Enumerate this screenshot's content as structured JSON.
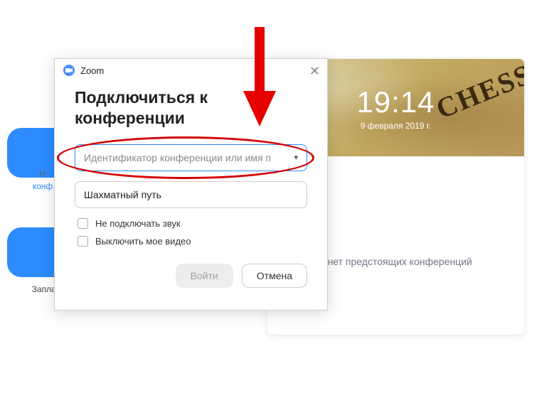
{
  "bg": {
    "tile1_label_top": "Н",
    "tile1_label_bottom": "конф",
    "tile2_label": "Заплан"
  },
  "calendar": {
    "time": "19:14",
    "date": "9 февраля 2019 г.",
    "decor_text": "CHESS",
    "body_text": "я нет предстоящих конференций"
  },
  "dialog": {
    "app_name": "Zoom",
    "title": "Подключиться к конференции",
    "meeting_id_placeholder": "Идентификатор конференции или имя п",
    "name_value": "Шахматный путь",
    "checkbox_no_audio": "Не подключать звук",
    "checkbox_no_video": "Выключить мое видео",
    "join_button": "Войти",
    "cancel_button": "Отмена"
  }
}
